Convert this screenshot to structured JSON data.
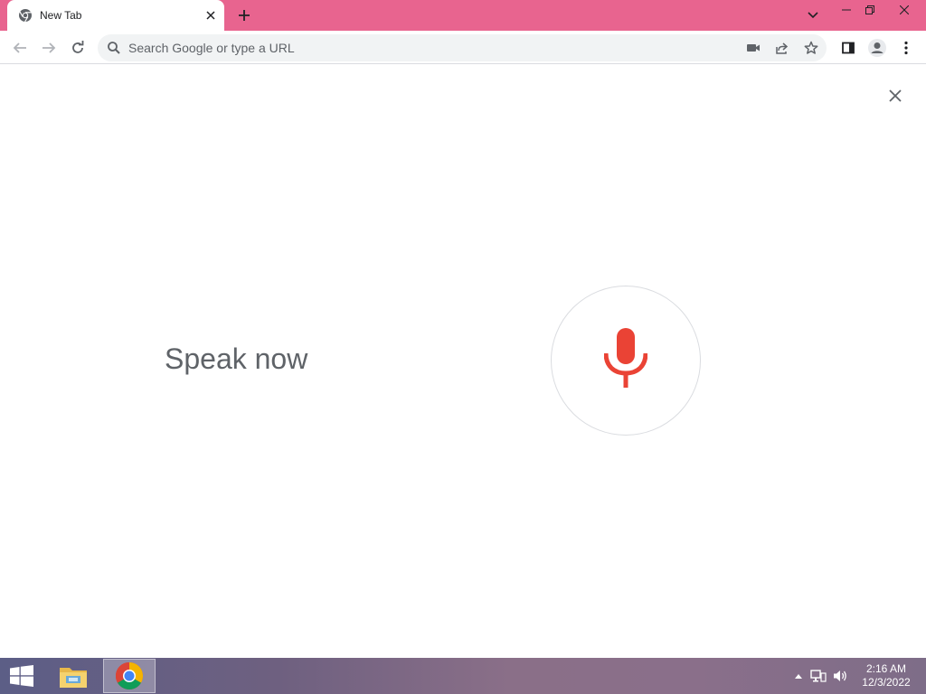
{
  "browser": {
    "tab": {
      "title": "New Tab",
      "favicon": "chrome-icon"
    },
    "window_controls": [
      "tab-search-icon",
      "minimize-icon",
      "restore-icon",
      "close-icon"
    ],
    "omnibox": {
      "placeholder": "Search Google or type a URL",
      "value": ""
    },
    "toolbar_icons": [
      "back-icon",
      "forward-icon",
      "reload-icon",
      "camera-icon",
      "share-icon",
      "star-icon",
      "side-panel-icon",
      "profile-icon",
      "menu-icon"
    ]
  },
  "voice_search": {
    "prompt": "Speak now",
    "mic_color": "#ea4335"
  },
  "taskbar": {
    "pinned": [
      "windows-start-icon",
      "file-explorer-icon",
      "chrome-icon"
    ],
    "clock": {
      "time": "2:16 AM",
      "date": "12/3/2022"
    }
  },
  "colors": {
    "titlebar": "#e8648f",
    "accent_red": "#ea4335"
  }
}
